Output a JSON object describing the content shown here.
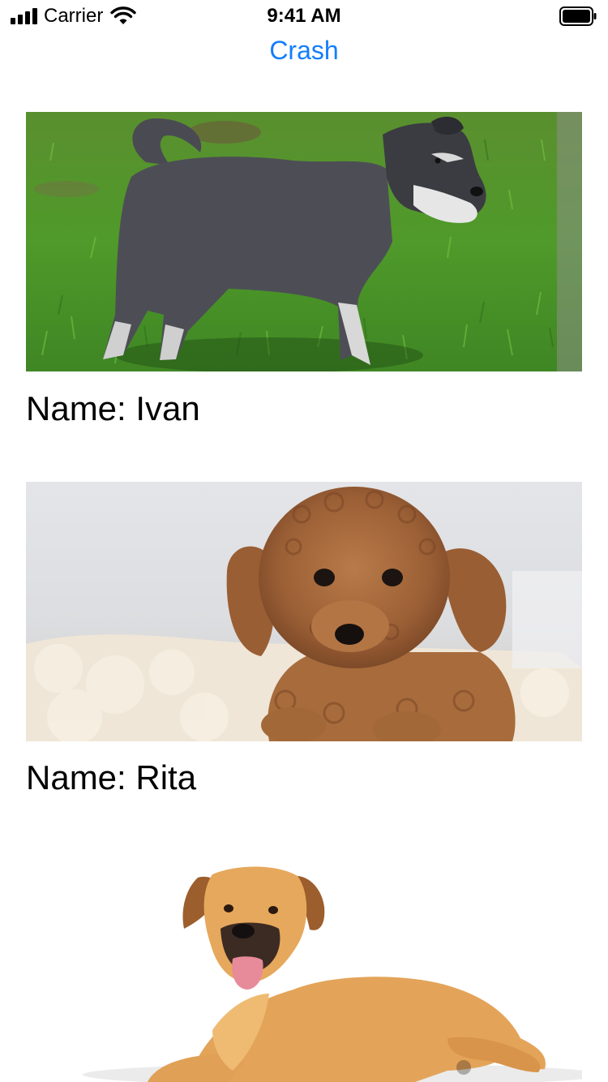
{
  "status_bar": {
    "carrier": "Carrier",
    "time": "9:41 AM",
    "signal_icon": "cellular-signal-icon",
    "wifi_icon": "wifi-icon",
    "battery_icon": "battery-icon"
  },
  "nav": {
    "crash_label": "Crash"
  },
  "colors": {
    "accent": "#147efb",
    "text": "#000000",
    "background": "#ffffff"
  },
  "dogs": [
    {
      "name_text": "Name: Ivan",
      "photo": "schnauzer-on-grass-photo"
    },
    {
      "name_text": "Name: Rita",
      "photo": "poodle-on-rug-photo"
    },
    {
      "name_text": "",
      "photo": "tan-dog-lying-photo"
    }
  ]
}
